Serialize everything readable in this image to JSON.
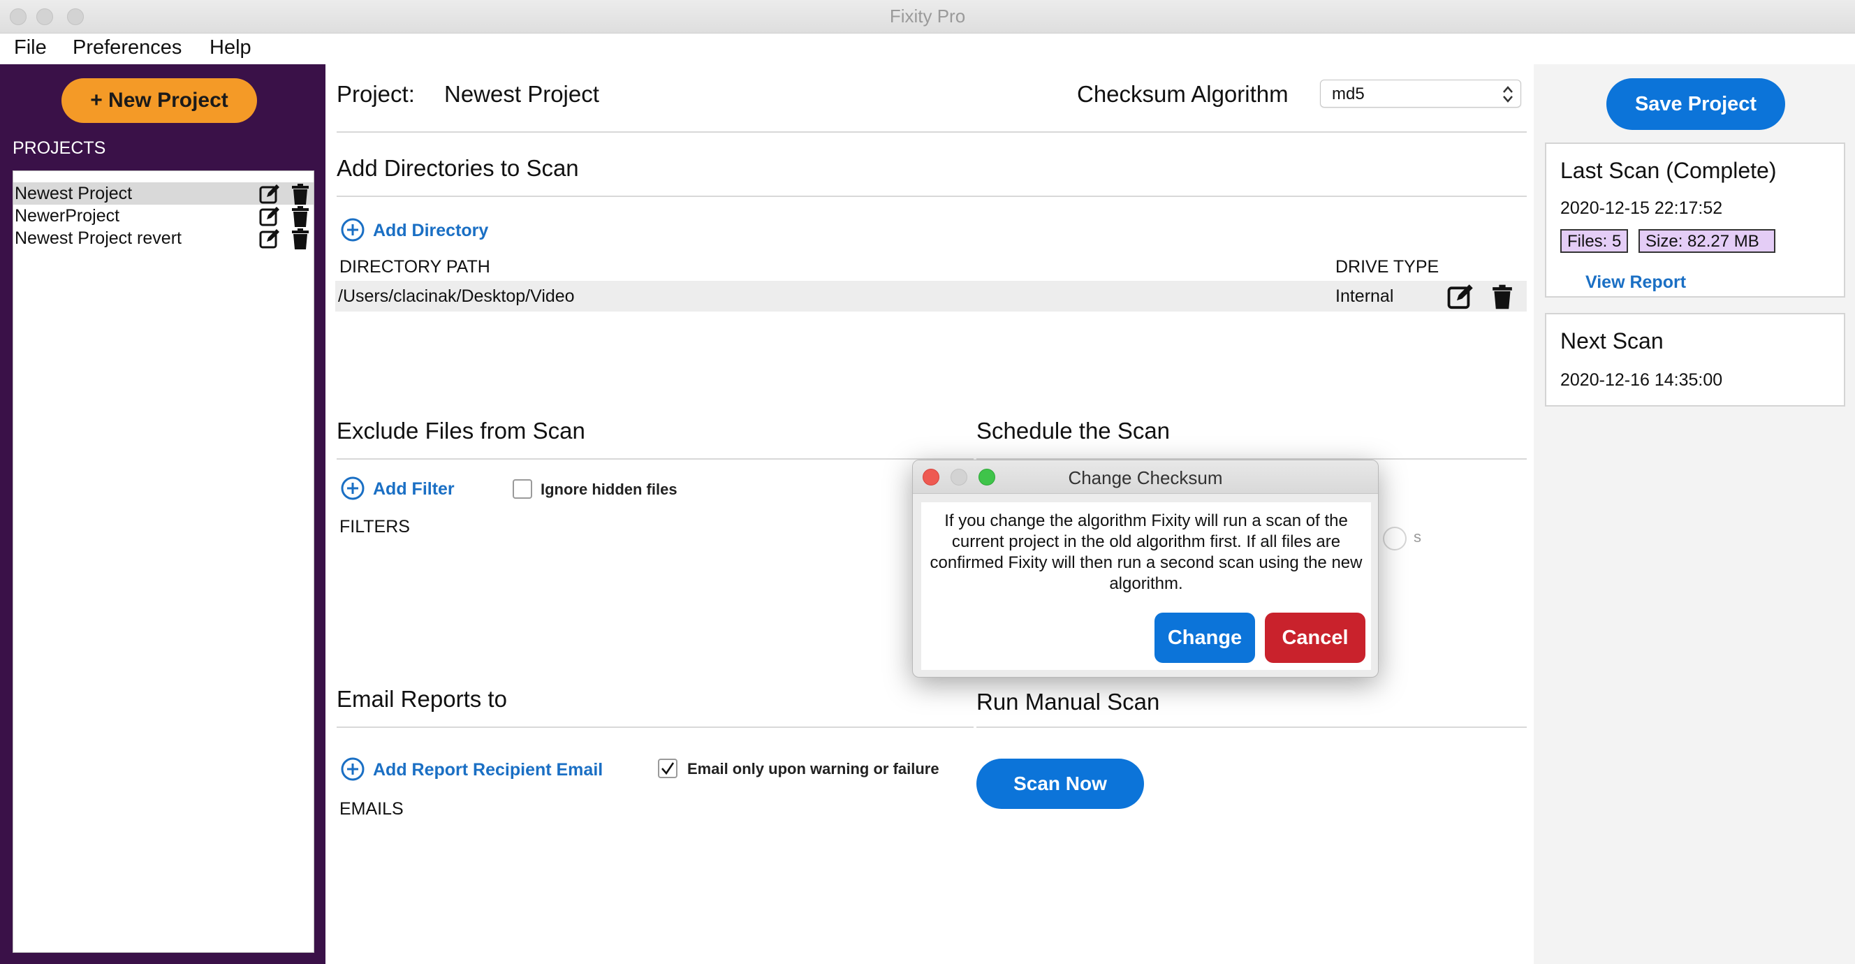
{
  "window": {
    "title": "Fixity Pro"
  },
  "menu": {
    "items": [
      "File",
      "Preferences",
      "Help"
    ]
  },
  "sidebar": {
    "new_project_label": "+ New Project",
    "projects_heading": "PROJECTS",
    "projects": [
      {
        "name": "Newest Project",
        "selected": true
      },
      {
        "name": "NewerProject",
        "selected": false
      },
      {
        "name": "Newest Project revert",
        "selected": false
      }
    ]
  },
  "main": {
    "project_label": "Project:",
    "project_name": "Newest Project",
    "checksum_label": "Checksum Algorithm",
    "checksum_value": "md5",
    "add_dirs_title": "Add Directories to Scan",
    "add_directory_label": "Add Directory",
    "directory_path_header": "DIRECTORY PATH",
    "drive_type_header": "DRIVE TYPE",
    "directories": [
      {
        "path": "/Users/clacinak/Desktop/Video",
        "drive_type": "Internal"
      }
    ],
    "exclude_title": "Exclude Files from Scan",
    "add_filter_label": "Add Filter",
    "ignore_hidden_label": "Ignore hidden files",
    "ignore_hidden_checked": false,
    "filters_label": "FILTERS",
    "schedule_title": "Schedule the Scan",
    "schedule_partial_text": "s",
    "email_title": "Email Reports to",
    "add_email_label": "Add Report Recipient Email",
    "email_only_label": "Email only upon warning or failure",
    "email_only_checked": true,
    "emails_label": "EMAILS",
    "manual_scan_title": "Run Manual Scan",
    "scan_now_label": "Scan Now"
  },
  "right_panel": {
    "save_project_label": "Save Project",
    "last_scan": {
      "title": "Last Scan (Complete)",
      "date": "2020-12-15 22:17:52",
      "files_badge": "Files: 5",
      "size_badge": "Size: 82.27 MB",
      "view_report_label": "View Report"
    },
    "next_scan": {
      "title": "Next Scan",
      "date": "2020-12-16 14:35:00"
    }
  },
  "dialog": {
    "title": "Change Checksum",
    "message": "If you change the algorithm Fixity will run a scan of the current project in the old algorithm first. If all files are confirmed Fixity will then run a second scan using the new algorithm.",
    "change_label": "Change",
    "cancel_label": "Cancel"
  },
  "colors": {
    "sidebar_bg": "#3a1148",
    "new_project_btn": "#f49a27",
    "primary_btn": "#0c74d9",
    "cancel_btn": "#c9222c",
    "link": "#1a6fc4",
    "badge_bg": "#e4cdf6"
  }
}
